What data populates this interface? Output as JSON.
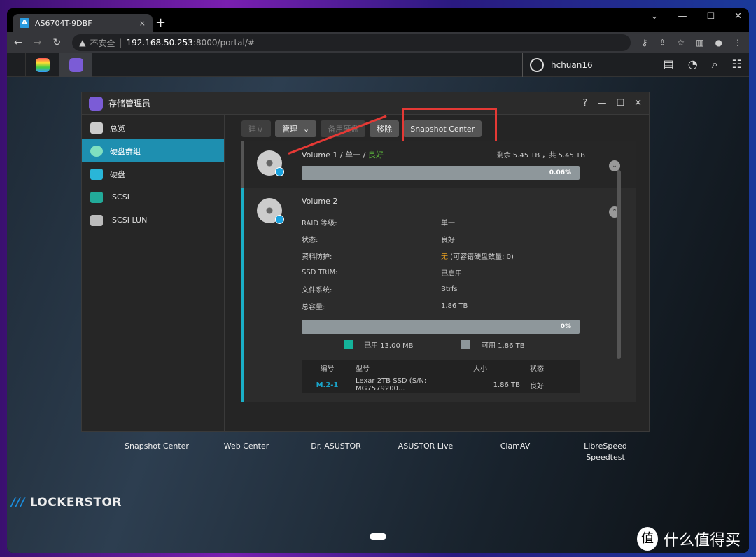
{
  "browser": {
    "tab_title": "AS6704T-9DBF",
    "tab_close": "×",
    "new_tab": "+",
    "win_controls": [
      "⌄",
      "—",
      "☐",
      "✕"
    ],
    "insecure": "不安全",
    "url_host": "192.168.50.253",
    "url_rest": ":8000/portal/#"
  },
  "portal": {
    "username": "hchuan16"
  },
  "dialog": {
    "title": "存储管理员",
    "controls": [
      "?",
      "—",
      "☐",
      "✕"
    ]
  },
  "sidebar": {
    "items": [
      {
        "label": "总览"
      },
      {
        "label": "硬盘群组"
      },
      {
        "label": "硬盘"
      },
      {
        "label": "iSCSI"
      },
      {
        "label": "iSCSI LUN"
      }
    ]
  },
  "toolbar": {
    "create": "建立",
    "manage": "管理",
    "spare": "备用硬盘",
    "remove": "移除",
    "snapshot": "Snapshot Center"
  },
  "volume1": {
    "name": "Volume 1",
    "sep1": " / 单一 / ",
    "status": "良好",
    "capacity": "剩余 5.45 TB ，共 5.45 TB",
    "usage": "0.06%",
    "usage_pct": 0.06
  },
  "volume2": {
    "name": "Volume 2",
    "details": [
      {
        "k": "RAID 等级:",
        "v": "单一"
      },
      {
        "k": "状态:",
        "v": "良好"
      },
      {
        "k": "资料防护:",
        "v": "无",
        "v2": " (可容错硬盘数量: 0)"
      },
      {
        "k": "SSD TRIM:",
        "v": "已启用"
      },
      {
        "k": "文件系统:",
        "v": "Btrfs"
      },
      {
        "k": "总容量:",
        "v": "1.86 TB"
      }
    ],
    "usage": "0%",
    "usage_pct": 0,
    "used": "已用 13.00 MB",
    "free": "可用 1.86 TB",
    "used_color": "#14b39a",
    "free_color": "#8e979b",
    "table": {
      "headers": [
        "编号",
        "型号",
        "大小",
        "状态"
      ],
      "rows": [
        [
          "M.2-1",
          "Lexar 2TB SSD (S/N: MG7579200...",
          "1.86 TB",
          "良好"
        ]
      ]
    }
  },
  "desktop": {
    "apps": [
      "Snapshot Center",
      "Web Center",
      "Dr. ASUSTOR",
      "ASUSTOR Live",
      "ClamAV",
      "LibreSpeed Speedtest"
    ],
    "logo": "LOCKERSTOR",
    "watermark": "什么值得买",
    "watermark_icon": "值"
  },
  "colors": {
    "accent": "#1e8fb0",
    "highlight": "#e53935",
    "good": "#5cb83c",
    "warn": "#e8a020"
  }
}
